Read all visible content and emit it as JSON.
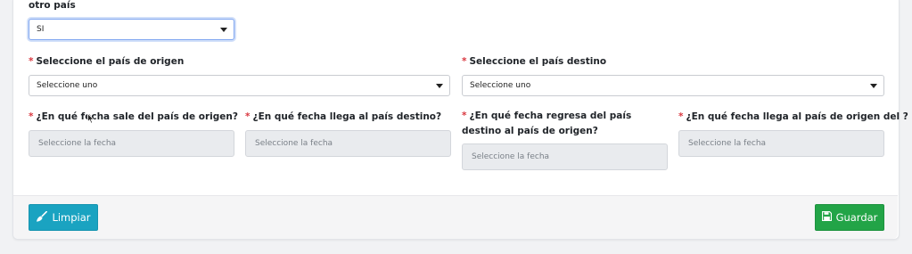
{
  "other_country": {
    "label": "otro país",
    "value": "SI"
  },
  "origin_country": {
    "label": "Seleccione el país de origen",
    "value": "Seleccione uno"
  },
  "destination_country": {
    "label": "Seleccione el país destino",
    "value": "Seleccione uno"
  },
  "dates": {
    "departure_label": "¿En qué fecha sale del país de origen?",
    "arrival_destination_label": "¿En qué fecha llega al país destino?",
    "return_label": "¿En qué fecha regresa del país destino al país de origen?",
    "arrival_origin_label": "¿En qué fecha llega al país de origen del ?",
    "placeholder": "Seleccione la fecha"
  },
  "required_mark": "*",
  "footer": {
    "clear_label": "Limpiar",
    "save_label": "Guardar"
  },
  "colors": {
    "clear_button": "#1aa3c1",
    "save_button": "#22a447",
    "required": "#d9363e"
  }
}
